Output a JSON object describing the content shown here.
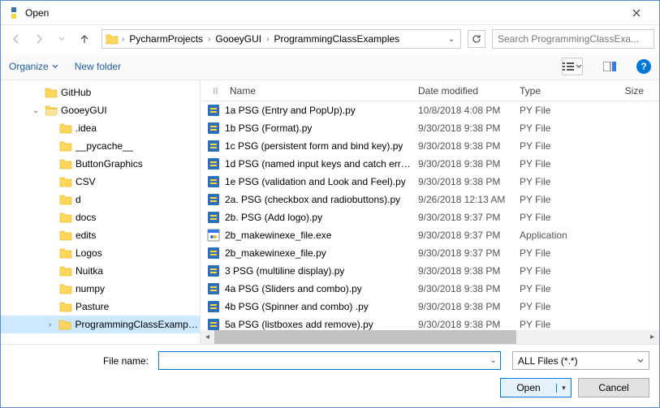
{
  "window": {
    "title": "Open"
  },
  "nav": {
    "back_enabled": false,
    "forward_enabled": false,
    "up_enabled": true,
    "breadcrumbs": [
      "PycharmProjects",
      "GooeyGUI",
      "ProgrammingClassExamples"
    ],
    "search_placeholder": "Search ProgrammingClassExa..."
  },
  "toolbar": {
    "organize_label": "Organize",
    "newfolder_label": "New folder"
  },
  "columns": {
    "name": "Name",
    "date": "Date modified",
    "type": "Type",
    "size": "Size"
  },
  "tree": [
    {
      "indent": 2,
      "label": "GitHub",
      "expander": "",
      "selected": false
    },
    {
      "indent": 2,
      "label": "GooeyGUI",
      "expander": "open",
      "selected": false
    },
    {
      "indent": 3,
      "label": ".idea",
      "expander": "",
      "selected": false
    },
    {
      "indent": 3,
      "label": "__pycache__",
      "expander": "",
      "selected": false
    },
    {
      "indent": 3,
      "label": "ButtonGraphics",
      "expander": "",
      "selected": false
    },
    {
      "indent": 3,
      "label": "CSV",
      "expander": "",
      "selected": false
    },
    {
      "indent": 3,
      "label": "d",
      "expander": "",
      "selected": false
    },
    {
      "indent": 3,
      "label": "docs",
      "expander": "",
      "selected": false
    },
    {
      "indent": 3,
      "label": "edits",
      "expander": "",
      "selected": false
    },
    {
      "indent": 3,
      "label": "Logos",
      "expander": "",
      "selected": false
    },
    {
      "indent": 3,
      "label": "Nuitka",
      "expander": "",
      "selected": false
    },
    {
      "indent": 3,
      "label": "numpy",
      "expander": "",
      "selected": false
    },
    {
      "indent": 3,
      "label": "Pasture",
      "expander": "",
      "selected": false
    },
    {
      "indent": 3,
      "label": "ProgrammingClassExamples",
      "expander": "closed",
      "selected": true
    }
  ],
  "files": [
    {
      "name": "1a PSG (Entry and PopUp).py",
      "date": "10/8/2018 4:08 PM",
      "type": "PY File",
      "icon": "py"
    },
    {
      "name": "1b PSG (Format).py",
      "date": "9/30/2018 9:38 PM",
      "type": "PY File",
      "icon": "py"
    },
    {
      "name": "1c PSG (persistent form and bind key).py",
      "date": "9/30/2018 9:38 PM",
      "type": "PY File",
      "icon": "py"
    },
    {
      "name": "1d PSG (named input keys and catch erro...",
      "date": "9/30/2018 9:38 PM",
      "type": "PY File",
      "icon": "py"
    },
    {
      "name": "1e PSG (validation and Look and Feel).py",
      "date": "9/30/2018 9:38 PM",
      "type": "PY File",
      "icon": "py"
    },
    {
      "name": "2a. PSG (checkbox and radiobuttons).py",
      "date": "9/26/2018 12:13 AM",
      "type": "PY File",
      "icon": "py"
    },
    {
      "name": "2b. PSG (Add logo).py",
      "date": "9/30/2018 9:37 PM",
      "type": "PY File",
      "icon": "py"
    },
    {
      "name": "2b_makewinexe_file.exe",
      "date": "9/30/2018 9:37 PM",
      "type": "Application",
      "icon": "exe"
    },
    {
      "name": "2b_makewinexe_file.py",
      "date": "9/30/2018 9:37 PM",
      "type": "PY File",
      "icon": "py"
    },
    {
      "name": "3 PSG (multiline display).py",
      "date": "9/30/2018 9:38 PM",
      "type": "PY File",
      "icon": "py"
    },
    {
      "name": "4a PSG (Sliders and combo).py",
      "date": "9/30/2018 9:38 PM",
      "type": "PY File",
      "icon": "py"
    },
    {
      "name": "4b PSG (Spinner and combo) .py",
      "date": "9/30/2018 9:38 PM",
      "type": "PY File",
      "icon": "py"
    },
    {
      "name": "5a PSG (listboxes add remove).py",
      "date": "9/30/2018 9:38 PM",
      "type": "PY File",
      "icon": "py"
    }
  ],
  "footer": {
    "filename_label": "File name:",
    "filename_value": "",
    "filter_label": "ALL Files (*.*)",
    "open_label": "Open",
    "cancel_label": "Cancel"
  }
}
